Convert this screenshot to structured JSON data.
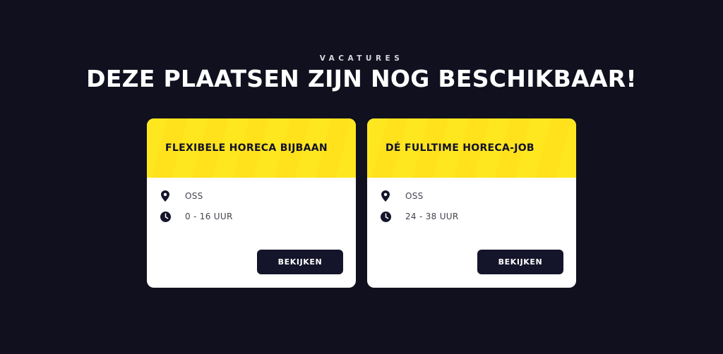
{
  "section": {
    "eyebrow": "VACATURES",
    "title": "DEZE PLAATSEN ZIJN NOG BESCHIKBAAR!"
  },
  "jobs": [
    {
      "title": "FLEXIBELE HORECA BIJBAAN",
      "location": "OSS",
      "hours": "0 - 16 UUR",
      "button_label": "BEKIJKEN",
      "location_icon": "location-pin-icon",
      "hours_icon": "clock-icon"
    },
    {
      "title": "DÉ FULLTIME HORECA-JOB",
      "location": "OSS",
      "hours": "24 - 38 UUR",
      "button_label": "BEKIJKEN",
      "location_icon": "location-pin-icon",
      "hours_icon": "clock-icon"
    }
  ],
  "colors": {
    "background": "#10101f",
    "card_header": "#ffe71f",
    "card_body": "#ffffff",
    "button": "#14142a",
    "text_dark": "#12122a"
  }
}
